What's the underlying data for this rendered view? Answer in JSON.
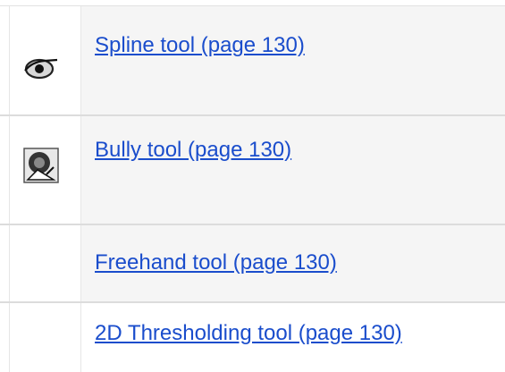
{
  "rows": [
    {
      "link": "Spline tool (page 130)",
      "icon": "spline-icon"
    },
    {
      "link": "Bully tool (page 130)",
      "icon": "bully-icon"
    },
    {
      "link": "Freehand tool (page 130)",
      "icon": null
    },
    {
      "link": "2D Thresholding tool (page 130)",
      "icon": null
    }
  ],
  "colors": {
    "link": "#1a4dcc",
    "row_shaded": "#f5f5f5",
    "divider": "#dcdcdc"
  }
}
